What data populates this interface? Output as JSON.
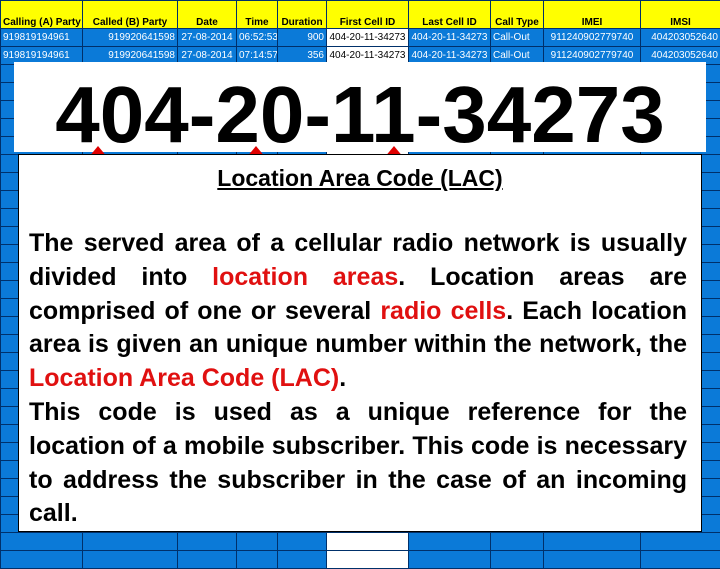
{
  "table": {
    "columns": [
      "Calling (A) Party",
      "Called (B) Party",
      "Date",
      "Time",
      "Duration",
      "First Cell ID",
      "Last Cell ID",
      "Call Type",
      "IMEI",
      "IMSI"
    ],
    "rows": [
      [
        "919819194961",
        "919920641598",
        "27-08-2014",
        "06:52:53",
        "900",
        "404-20-11-34273",
        "404-20-11-34273",
        "Call-Out",
        "911240902779740",
        "404203052640"
      ],
      [
        "919819194961",
        "919920641598",
        "27-08-2014",
        "07:14:57",
        "356",
        "404-20-11-34273",
        "404-20-11-34273",
        "Call-Out",
        "911240902779740",
        "404203052640"
      ]
    ]
  },
  "overlay": {
    "big_id": "404-20-11-34273",
    "title": "Location Area Code (LAC)",
    "p1": "The served area of a cellular radio network is usually divided into ",
    "r1": "location areas",
    "p2": ". Location areas are comprised of one or several ",
    "r2": "radio cells",
    "p3": ". Each location area is given an unique number within the network, the ",
    "r3": "Location Area Code (LAC)",
    "p4": ".",
    "p5": "This code is used as a unique reference for the location of a mobile subscriber. This code is necessary to address the subscriber in the case of an incoming call."
  },
  "colors": {
    "header_bg": "#ffff00",
    "grid_bg": "#0b7ad8",
    "highlight": "#e01010"
  }
}
